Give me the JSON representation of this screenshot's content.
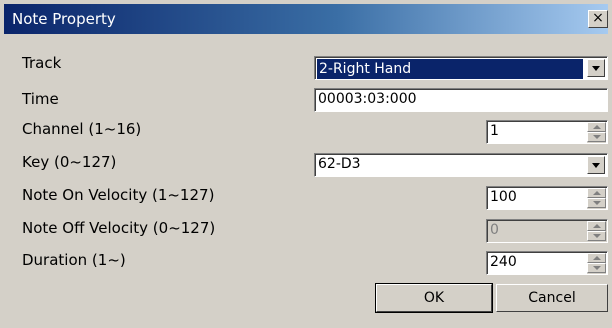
{
  "dialog": {
    "title": "Note Property",
    "close_glyph": "×"
  },
  "labels": {
    "track": "Track",
    "time": "Time",
    "channel": "Channel (1~16)",
    "key": "Key (0~127)",
    "note_on_velocity": "Note On Velocity (1~127)",
    "note_off_velocity": "Note Off Velocity (0~127)",
    "duration": "Duration (1~)"
  },
  "fields": {
    "track": "2-Right Hand",
    "time": "00003:03:000",
    "channel": "1",
    "key": "62-D3",
    "note_on_velocity": "100",
    "note_off_velocity": "0",
    "duration": "240"
  },
  "buttons": {
    "ok": "OK",
    "cancel": "Cancel"
  },
  "colors": {
    "title_start": "#0a246a",
    "title_end": "#a6caf0",
    "face": "#d4d0c8"
  }
}
